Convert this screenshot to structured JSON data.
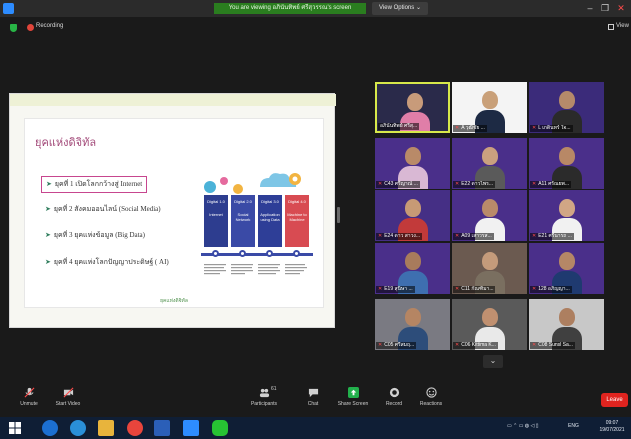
{
  "titlebar": {
    "banner": "You are viewing อภินันทิพย์ ศรีสุวรรณ's screen",
    "view_options": "View Options ⌄",
    "minimize": "–",
    "restore": "❐",
    "close": "✕"
  },
  "status": {
    "recording": "Recording",
    "view": "View"
  },
  "slide": {
    "title": "ยุคแห่งดิจิทัล",
    "eras": [
      "ยุคที่ 1 เปิดโลกกว้างสู่ Internet",
      "ยุคที่ 2 สังคมออนไลน์ (Social Media)",
      "ยุคที่ 3 ยุคแห่งข้อมูล (Big Data)",
      "ยุคที่ 4 ยุคแห่งโลกปัญญาประดิษฐ์ ( AI)"
    ],
    "digital": [
      {
        "label": "Digital 1.0",
        "sub": "Internet"
      },
      {
        "label": "Digital 2.0",
        "sub": "Social Network"
      },
      {
        "label": "Digital 3.0",
        "sub": "Application using Data"
      },
      {
        "label": "Digital 4.0",
        "sub": "Machine to Machine"
      }
    ],
    "footer": "ยุคแห่งดิจิทัล"
  },
  "participants": [
    {
      "name": "อภินันทิพย์ ศรีสุ...",
      "muted": false
    },
    {
      "name": "A วุฒิชัย ...",
      "muted": true
    },
    {
      "name": "L เกดินทร์ ใจ...",
      "muted": true
    },
    {
      "name": "C43 ศรีญาณ์ ...",
      "muted": true
    },
    {
      "name": "E22 ดาวไพร...",
      "muted": true
    },
    {
      "name": "A11 ศรัณยพ...",
      "muted": true
    },
    {
      "name": "E24 ดาว สาวง...",
      "muted": true
    },
    {
      "name": "A09 เสาวรส...",
      "muted": true
    },
    {
      "name": "E21 ศรีนารถ ...",
      "muted": true
    },
    {
      "name": "E19 สุนิษา ...",
      "muted": true
    },
    {
      "name": "C11 กัณฑิมา...",
      "muted": true
    },
    {
      "name": "128 อภิญญา...",
      "muted": true
    },
    {
      "name": "C05 ศรีสมฤ...",
      "muted": true
    },
    {
      "name": "C06 Kittima K...",
      "muted": true
    },
    {
      "name": "C08 Sunsl Sa...",
      "muted": true
    }
  ],
  "toolbar": {
    "unmute": "Unmute",
    "start_video": "Start Video",
    "participants": "Participants",
    "participants_count": "61",
    "chat": "Chat",
    "share_screen": "Share Screen",
    "record": "Record",
    "reactions": "Reactions",
    "leave": "Leave"
  },
  "taskbar": {
    "lang": "ENG",
    "time": "09:07",
    "date": "19/07/2021"
  },
  "colors": {
    "accent_green": "#2a7d1f",
    "leave_red": "#e0241f",
    "selected_border": "#d7e84a"
  }
}
